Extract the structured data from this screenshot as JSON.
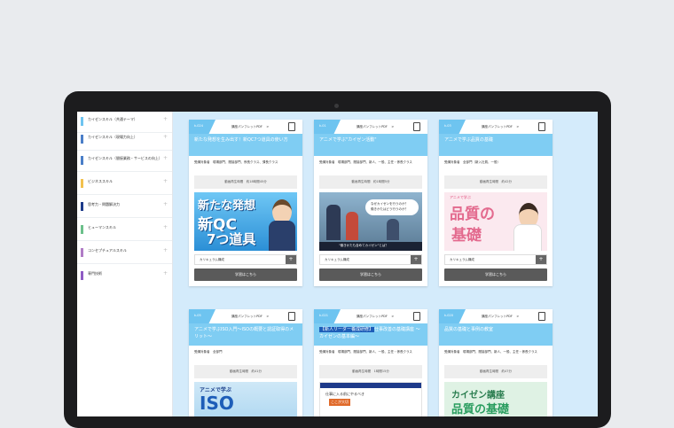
{
  "sidebar": {
    "items": [
      {
        "label": "カイゼンスキル（共通テーマ）",
        "color": "#6ec4f0"
      },
      {
        "label": "カイゼンスキル（現場力向上）",
        "color": "#4a7ec8"
      },
      {
        "label": "カイゼンスキル（間接業務・サービスの向上）",
        "color": "#4a7ec8"
      },
      {
        "label": "ビジネススキル",
        "color": "#f2c14e"
      },
      {
        "label": "思考力・問題解決力",
        "color": "#1d3a8a"
      },
      {
        "label": "ヒューマンスキル",
        "color": "#6cc08b"
      },
      {
        "label": "コンセプチュアルスキル",
        "color": "#b07cc6"
      },
      {
        "label": "専門技術",
        "color": "#8e5bc4"
      }
    ],
    "plus": "+"
  },
  "cards": [
    {
      "code": "k-024",
      "pdf": "講座パンフレットPDF",
      "arrow": ">",
      "tag": "",
      "title": "新たな発想を生み出す！新QC7つ道具の使い方",
      "target": "受講対象者　現場部門、間接部門、係長クラス、課長クラス",
      "time": "動画再生時間　約18時間45分",
      "thumb_lines": [
        "新たな発想",
        "新QC",
        "7つ道具"
      ],
      "curriculum": "カリキュラム構成",
      "plus": "+",
      "learn": "学習はこちら"
    },
    {
      "code": "k-01",
      "pdf": "講座パンフレットPDF",
      "arrow": ">",
      "tag": "",
      "title": "アニメで学ぶ\"カイゼン活動\"",
      "target": "受講対象者　現場部門、間接部門、新人、一般、主任・係長クラス",
      "time": "動画再生時間　約1時間5分",
      "thumb_lines": [
        "なぜカイゼンを行うのか？",
        "働きかたはどう行うのか？",
        "\"働きかたも含めてカイゼン\"とは？"
      ],
      "curriculum": "カリキュラム構成",
      "plus": "+",
      "learn": "学習はこちら"
    },
    {
      "code": "k-03",
      "pdf": "講座パンフレットPDF",
      "arrow": ">",
      "tag": "",
      "title": "アニメで学ぶ品質の基礎",
      "target": "受講対象者　全部門（新入社員、一般）",
      "time": "動画再生時間　約42分",
      "thumb_lines": [
        "アニメで学ぶ",
        "品質の",
        "基礎"
      ],
      "curriculum": "カリキュラム構成",
      "plus": "+",
      "learn": "学習はこちら"
    },
    {
      "code": "k-05",
      "pdf": "講座パンフレットPDF",
      "arrow": ">",
      "tag": "",
      "title": "アニメで学ぶISO入門～ISOの概要と認証取得のメリット～",
      "target": "受講対象者　全部門",
      "time": "動画再生時間　約41分",
      "thumb_lines": [
        "アニメで学ぶ",
        "ISO"
      ],
      "curriculum": "",
      "plus": "",
      "learn": ""
    },
    {
      "code": "k-021",
      "pdf": "講座パンフレットPDF",
      "arrow": ">",
      "tag": "【新人リーダー養成研修】",
      "title": "仕事改善の基礎講座 ～カイゼンの基本編～",
      "target": "受講対象者　現場部門、間接部門、新人、一般、主任・係長クラス",
      "time": "動画再生時間　1時間15分",
      "thumb_lines": [
        "仕事に入る前にやるべき",
        "ここが大切"
      ],
      "curriculum": "",
      "plus": "",
      "learn": ""
    },
    {
      "code": "k-020",
      "pdf": "講座パンフレットPDF",
      "arrow": ">",
      "tag": "",
      "title": "品質の基礎と事例の教室",
      "target": "受講対象者　現場部門、間接部門、新人、一般、主任・係長クラス",
      "time": "動画再生時間　約47分",
      "thumb_lines": [
        "カイゼン講座",
        "品質の基礎"
      ],
      "curriculum": "",
      "plus": "",
      "learn": ""
    }
  ]
}
